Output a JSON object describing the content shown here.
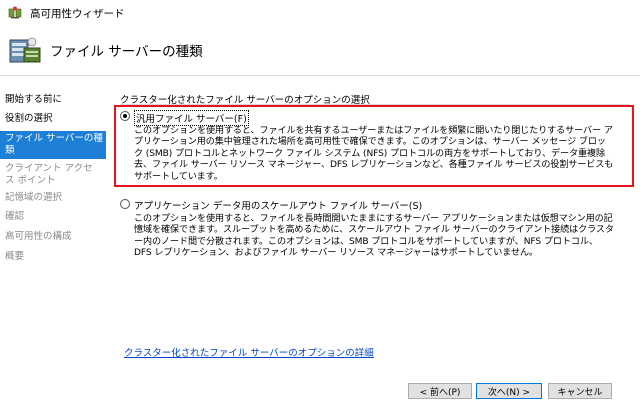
{
  "window": {
    "title": "高可用性ウィザード"
  },
  "header": {
    "title": "ファイル サーバーの種類"
  },
  "sidebar": {
    "items": [
      {
        "label": "開始する前に",
        "state": "normal"
      },
      {
        "label": "役割の選択",
        "state": "normal"
      },
      {
        "label": "ファイル サーバーの種類",
        "state": "active"
      },
      {
        "label": "クライアント アクセス ポイント",
        "state": "disabled"
      },
      {
        "label": "記憶域の選択",
        "state": "disabled"
      },
      {
        "label": "確認",
        "state": "disabled"
      },
      {
        "label": "高可用性の構成",
        "state": "disabled"
      },
      {
        "label": "概要",
        "state": "disabled"
      }
    ]
  },
  "main": {
    "section_label": "クラスター化されたファイル サーバーのオプションの選択",
    "options": [
      {
        "label": "汎用ファイル サーバー(F)",
        "checked": true,
        "description": "このオプションを使用すると、ファイルを共有するユーザーまたはファイルを頻繁に開いたり閉じたりするサーバー アプリケーション用の集中管理された場所を高可用性で確保できます。このオプションは、サーバー メッセージ ブロック (SMB) プロトコルとネットワーク ファイル システム (NFS) プロトコルの両方をサポートしており、データ重複除去、ファイル サーバー リソース マネージャー、DFS レプリケーションなど、各種ファイル サービスの役割サービスもサポートしています。"
      },
      {
        "label": "アプリケーション データ用のスケールアウト ファイル サーバー(S)",
        "checked": false,
        "description": "このオプションを使用すると、ファイルを長時間開いたままにするサーバー アプリケーションまたは仮想マシン用の記憶域を確保できます。スループットを高めるために、スケールアウト ファイル サーバーのクライアント接続はクラスター内のノード間で分散されます。このオプションは、SMB プロトコルをサポートしていますが、NFS プロトコル、DFS レプリケーション、およびファイル サーバー リソース マネージャーはサポートしていません。"
      }
    ],
    "more_link": "クラスター化されたファイル サーバーのオプションの詳細"
  },
  "buttons": {
    "back": "< 前へ(P)",
    "next": "次へ(N) >",
    "cancel": "キャンセル"
  },
  "colors": {
    "accent": "#1e7fd6",
    "highlight": "#e8121b",
    "link": "#0645c8"
  },
  "icons": {
    "app": "cluster-icon",
    "header": "file-server-icon"
  }
}
